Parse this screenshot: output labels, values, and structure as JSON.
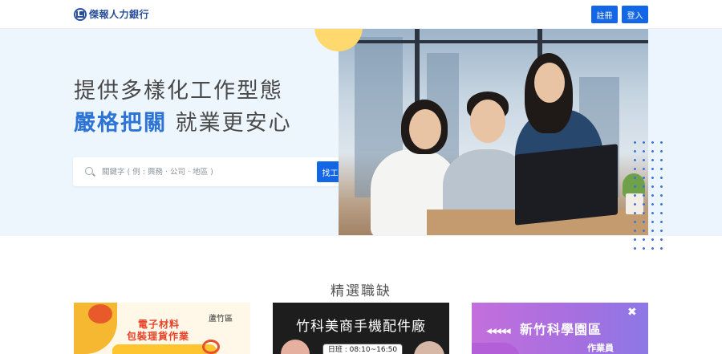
{
  "header": {
    "logo_text": "傑報人力銀行",
    "register_label": "註冊",
    "login_label": "登入"
  },
  "hero": {
    "headline_line1": "提供多樣化工作型態",
    "headline_highlight": "嚴格把關",
    "headline_rest": "就業更安心",
    "search": {
      "placeholder": "關鍵字 ( 例 : 興務 · 公司 · 地區 )",
      "value": "",
      "button_label": "找工作"
    }
  },
  "featured": {
    "title": "精選職缺",
    "cards": [
      {
        "line1": "電子材料",
        "line2": "包裝理貨作業",
        "area": "蘆竹區"
      },
      {
        "title": "竹科美商手機配件廠",
        "time": "日班 : 08:10~16:50"
      },
      {
        "arrows": "◀◀◀◀◀",
        "title": "新竹科學園區",
        "subtitle": "作業員",
        "close": "✖"
      }
    ]
  },
  "colors": {
    "primary": "#1366e6",
    "highlight": "#2d74d6",
    "hero_bg": "#edf6fd",
    "logo": "#2a4f9a"
  }
}
